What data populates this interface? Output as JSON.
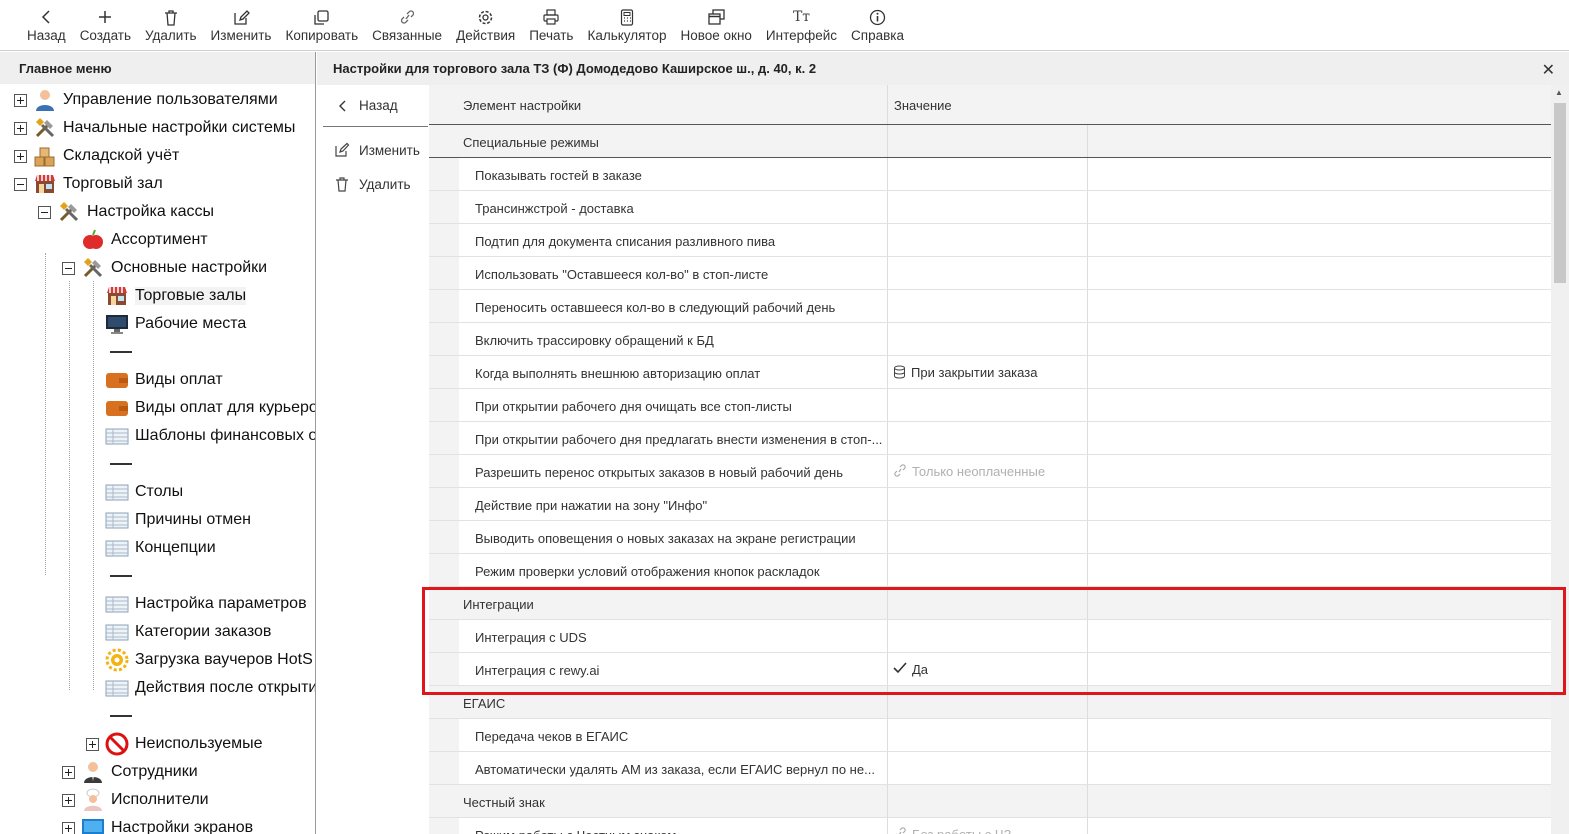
{
  "toolbar": {
    "buttons": [
      {
        "label": "Назад",
        "icon": "chevron-left-icon"
      },
      {
        "label": "Создать",
        "icon": "plus-icon"
      },
      {
        "label": "Удалить",
        "icon": "trash-icon"
      },
      {
        "label": "Изменить",
        "icon": "edit-icon"
      },
      {
        "label": "Копировать",
        "icon": "copy-icon"
      },
      {
        "label": "Связанные",
        "icon": "link-icon"
      },
      {
        "label": "Действия",
        "icon": "gear-icon"
      },
      {
        "label": "Печать",
        "icon": "printer-icon"
      },
      {
        "label": "Калькулятор",
        "icon": "calculator-icon"
      },
      {
        "label": "Новое окно",
        "icon": "new-window-icon"
      },
      {
        "label": "Интерфейс",
        "icon": "font-icon"
      },
      {
        "label": "Справка",
        "icon": "info-icon"
      }
    ]
  },
  "left": {
    "title": "Главное меню",
    "tree": [
      {
        "label": "Управление пользователями",
        "icon": "user-icon",
        "level": 0,
        "expander": "plus"
      },
      {
        "label": "Начальные настройки системы",
        "icon": "tools-icon",
        "level": 0,
        "expander": "plus"
      },
      {
        "label": "Складской учёт",
        "icon": "boxes-icon",
        "level": 0,
        "expander": "plus"
      },
      {
        "label": "Торговый зал",
        "icon": "store-icon",
        "level": 0,
        "expander": "minus"
      },
      {
        "label": "Настройка кассы",
        "icon": "tools-icon",
        "level": 1,
        "expander": "minus"
      },
      {
        "label": "Ассортимент",
        "icon": "apple-icon",
        "level": 2,
        "expander": ""
      },
      {
        "label": "Основные настройки",
        "icon": "tools-icon",
        "level": 2,
        "expander": "minus"
      },
      {
        "label": "Торговые залы",
        "icon": "store-icon",
        "level": 3,
        "expander": "",
        "selected": true
      },
      {
        "label": "Рабочие места",
        "icon": "monitor-icon",
        "level": 3,
        "expander": ""
      },
      {
        "label": "",
        "icon": "separator",
        "level": 3,
        "expander": ""
      },
      {
        "label": "Виды оплат",
        "icon": "wallet-icon",
        "level": 3,
        "expander": ""
      },
      {
        "label": "Виды оплат для курьеро",
        "icon": "wallet-icon",
        "level": 3,
        "expander": ""
      },
      {
        "label": "Шаблоны финансовых о",
        "icon": "table-icon",
        "level": 3,
        "expander": ""
      },
      {
        "label": "",
        "icon": "separator",
        "level": 3,
        "expander": ""
      },
      {
        "label": "Столы",
        "icon": "table-icon",
        "level": 3,
        "expander": ""
      },
      {
        "label": "Причины отмен",
        "icon": "table-icon",
        "level": 3,
        "expander": ""
      },
      {
        "label": "Концепции",
        "icon": "table-icon",
        "level": 3,
        "expander": ""
      },
      {
        "label": "",
        "icon": "separator",
        "level": 3,
        "expander": ""
      },
      {
        "label": "Настройка параметров",
        "icon": "table-icon",
        "level": 3,
        "expander": ""
      },
      {
        "label": "Категории заказов",
        "icon": "table-icon",
        "level": 3,
        "expander": ""
      },
      {
        "label": "Загрузка ваучеров HotS",
        "icon": "sun-gear-icon",
        "level": 3,
        "expander": ""
      },
      {
        "label": "Действия после открыти",
        "icon": "table-icon",
        "level": 3,
        "expander": ""
      },
      {
        "label": "",
        "icon": "separator",
        "level": 3,
        "expander": ""
      },
      {
        "label": "Неиспользуемые",
        "icon": "forbidden-icon",
        "level": 3,
        "expander": "plus"
      },
      {
        "label": "Сотрудники",
        "icon": "employee-icon",
        "level": 2,
        "expander": "plus"
      },
      {
        "label": "Исполнители",
        "icon": "chef-icon",
        "level": 2,
        "expander": "plus"
      },
      {
        "label": "Настройки экранов",
        "icon": "screen-icon",
        "level": 2,
        "expander": "plus"
      }
    ]
  },
  "panel": {
    "title": "Настройки для торгового зала ТЗ (Ф) Домодедово Каширское ш., д. 40, к. 2",
    "back_label": "Назад",
    "edit_label": "Изменить",
    "delete_label": "Удалить",
    "columns": {
      "setting": "Элемент настройки",
      "value": "Значение"
    },
    "rows": [
      {
        "type": "group",
        "label": "Специальные режимы",
        "value": ""
      },
      {
        "type": "item",
        "label": "Показывать гостей в заказе",
        "value": ""
      },
      {
        "type": "item",
        "label": "Трансинжстрой - доставка",
        "value": ""
      },
      {
        "type": "item",
        "label": "Подтип для документа списания разливного пива",
        "value": ""
      },
      {
        "type": "item",
        "label": "Использовать \"Оставшееся кол-во\" в стоп-листе",
        "value": ""
      },
      {
        "type": "item",
        "label": "Переносить оставшееся кол-во в следующий рабочий день",
        "value": ""
      },
      {
        "type": "item",
        "label": "Включить трассировку обращений к БД",
        "value": ""
      },
      {
        "type": "item",
        "label": "Когда выполнять внешнюю авторизацию оплат",
        "value": "При закрытии заказа",
        "value_icon": "database-icon"
      },
      {
        "type": "item",
        "label": "При открытии рабочего дня очищать все стоп-листы",
        "value": ""
      },
      {
        "type": "item",
        "label": "При открытии рабочего дня предлагать внести изменения в стоп-...",
        "value": ""
      },
      {
        "type": "item",
        "label": "Разрешить перенос открытых заказов в новый рабочий день",
        "value": "Только неоплаченные",
        "value_icon": "link-icon",
        "dim": true
      },
      {
        "type": "item",
        "label": "Действие при нажатии на зону \"Инфо\"",
        "value": ""
      },
      {
        "type": "item",
        "label": "Выводить оповещения о новых заказах на экране регистрации",
        "value": ""
      },
      {
        "type": "item",
        "label": "Режим проверки условий отображения кнопок раскладок",
        "value": ""
      },
      {
        "type": "group",
        "label": "Интеграции",
        "value": ""
      },
      {
        "type": "item",
        "label": "Интеграция с UDS",
        "value": ""
      },
      {
        "type": "item",
        "label": "Интеграция с rewy.ai",
        "value": "Да",
        "value_icon": "check-icon"
      },
      {
        "type": "group",
        "label": "ЕГАИС",
        "value": ""
      },
      {
        "type": "item",
        "label": "Передача чеков в ЕГАИС",
        "value": ""
      },
      {
        "type": "item",
        "label": "Автоматически удалять АМ из заказа, если ЕГАИС вернул по не...",
        "value": ""
      },
      {
        "type": "group",
        "label": "Честный знак",
        "value": ""
      },
      {
        "type": "item",
        "label": "Режим работы с Честным знаком",
        "value": "Без работы с ЧЗ",
        "value_icon": "link-icon",
        "dim": true
      }
    ]
  },
  "colors": {
    "highlight": "#e0161d",
    "header_bg": "#efefef"
  }
}
